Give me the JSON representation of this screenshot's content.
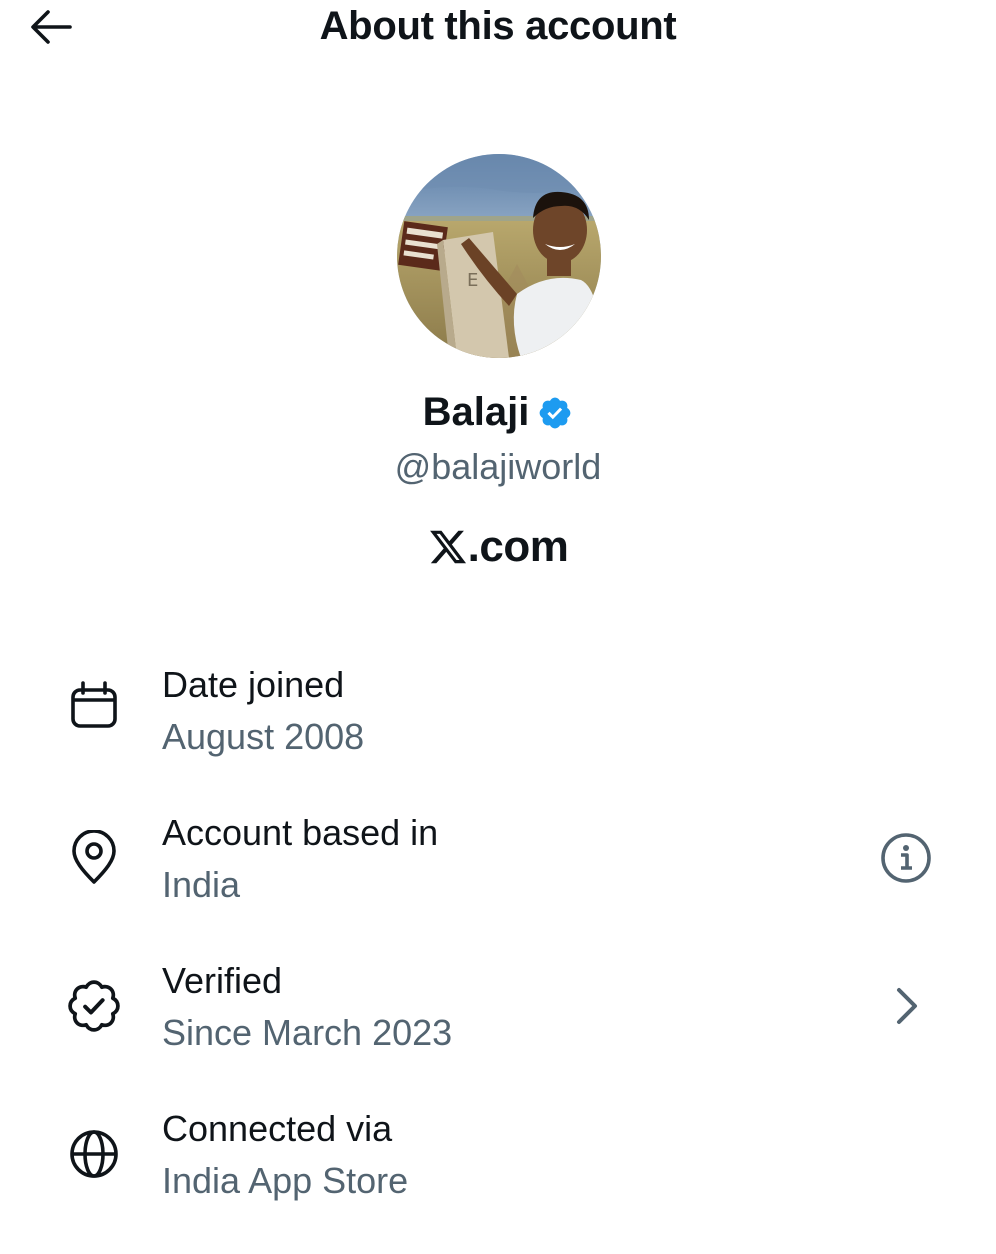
{
  "header": {
    "title": "About this account",
    "back_icon": "arrow-left-icon"
  },
  "profile": {
    "display_name": "Balaji",
    "handle": "@balajiworld",
    "verified_icon": "verified-badge-icon",
    "verified_color": "#1d9bf0",
    "avatar": "profile-photo"
  },
  "brand": {
    "label": ".com",
    "logo_icon": "x-logo-icon"
  },
  "details": [
    {
      "title": "Date joined",
      "value": "August 2008",
      "icon": "calendar-icon"
    },
    {
      "title": "Account based in",
      "value": "India",
      "icon": "location-pin-icon",
      "action_icon": "info-icon"
    },
    {
      "title": "Verified",
      "value": "Since March 2023",
      "icon": "verified-outline-icon",
      "action_icon": "chevron-right-icon"
    },
    {
      "title": "Connected via",
      "value": "India App Store",
      "icon": "globe-icon"
    }
  ],
  "colors": {
    "text_primary": "#0f1419",
    "text_secondary": "#536471"
  }
}
